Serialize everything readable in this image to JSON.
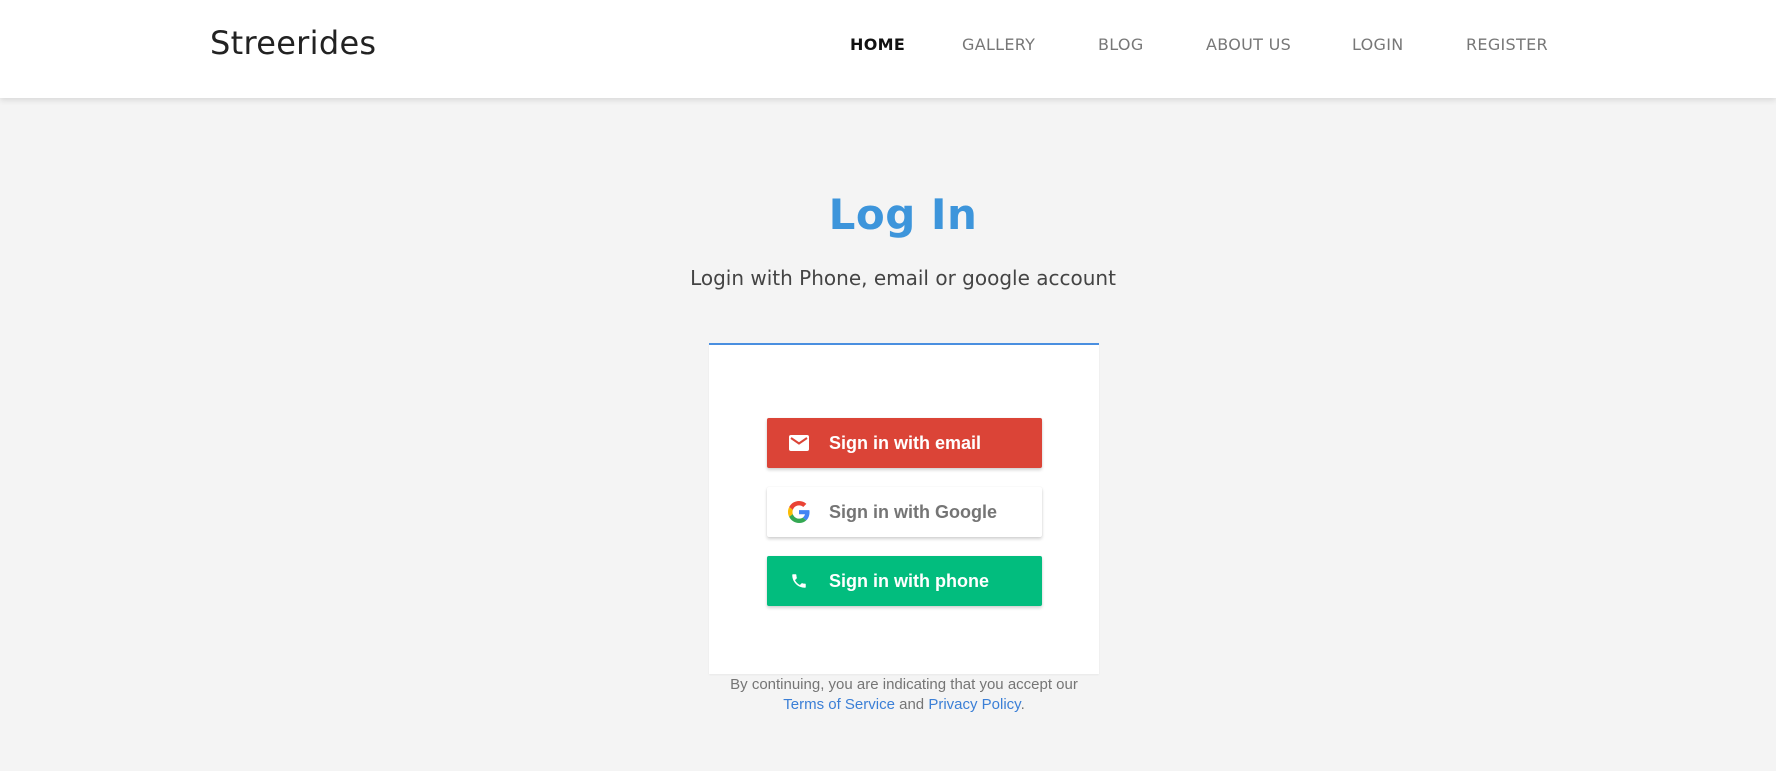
{
  "header": {
    "brand": "Streerides",
    "nav": [
      {
        "label": "HOME",
        "active": true
      },
      {
        "label": "GALLERY",
        "active": false
      },
      {
        "label": "BLOG",
        "active": false
      },
      {
        "label": "ABOUT US",
        "active": false
      },
      {
        "label": "LOGIN",
        "active": false
      },
      {
        "label": "REGISTER",
        "active": false
      }
    ]
  },
  "main": {
    "title": "Log In",
    "subtitle": "Login with Phone, email or google account"
  },
  "auth": {
    "buttons": [
      {
        "label": "Sign in with email",
        "icon": "mail-icon",
        "color": "#db4437"
      },
      {
        "label": "Sign in with Google",
        "icon": "google-icon",
        "color": "#ffffff"
      },
      {
        "label": "Sign in with phone",
        "icon": "phone-icon",
        "color": "#02bd7e"
      }
    ],
    "terms": {
      "prefix": "By continuing, you are indicating that you accept our",
      "tos_link": "Terms of Service",
      "conjunction": "and",
      "privacy_link": "Privacy Policy",
      "suffix": "."
    }
  },
  "colors": {
    "accent": "#3d95db",
    "background": "#f4f4f4",
    "link": "#3b7fd6"
  }
}
